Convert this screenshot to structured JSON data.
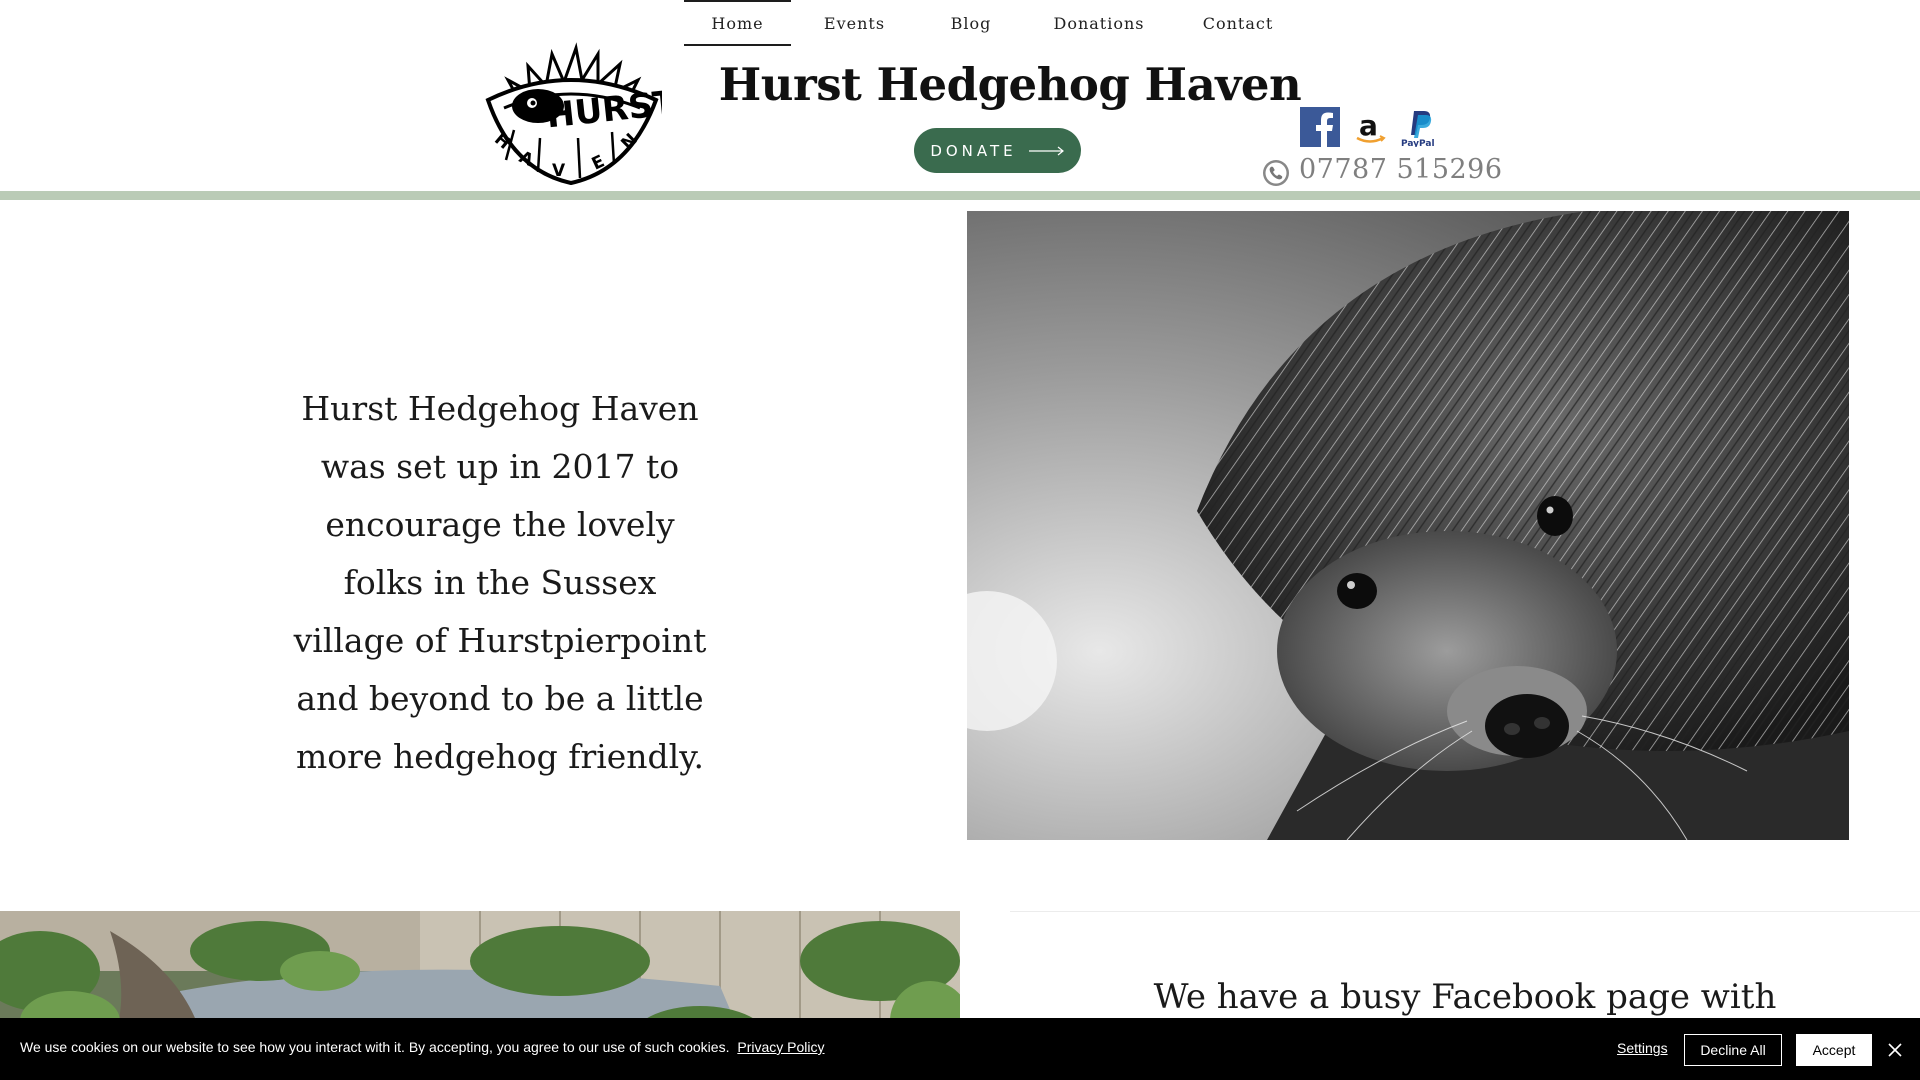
{
  "nav": {
    "items": [
      {
        "label": "Home",
        "active": true
      },
      {
        "label": "Events",
        "active": false
      },
      {
        "label": "Blog",
        "active": false
      },
      {
        "label": "Donations",
        "active": false
      },
      {
        "label": "Contact",
        "active": false
      }
    ]
  },
  "header": {
    "title": "Hurst Hedgehog Haven",
    "donate_label": "DONATE",
    "phone": "07787 515296",
    "logo_text": "HURST HAVEN",
    "social_icons": [
      "facebook-icon",
      "amazon-icon",
      "paypal-icon"
    ],
    "paypal_label": "PayPal"
  },
  "intro": {
    "text": "Hurst Hedgehog Haven was set up in 2017 to encourage the lovely folks in the Sussex village of Hurstpierpoint and beyond to be a little more hedgehog friendly."
  },
  "facebook_section": {
    "text": "We have a busy Facebook page with loads of hoggie pics and advise"
  },
  "cookie": {
    "message": "We use cookies on our website to see how you interact with it. By accepting, you agree to our use of such cookies.",
    "privacy_link": "Privacy Policy",
    "settings": "Settings",
    "decline": "Decline All",
    "accept": "Accept"
  },
  "colors": {
    "brand_green": "#3a6b4e",
    "divider_green": "#bacbb6",
    "facebook_blue": "#3b5998"
  }
}
